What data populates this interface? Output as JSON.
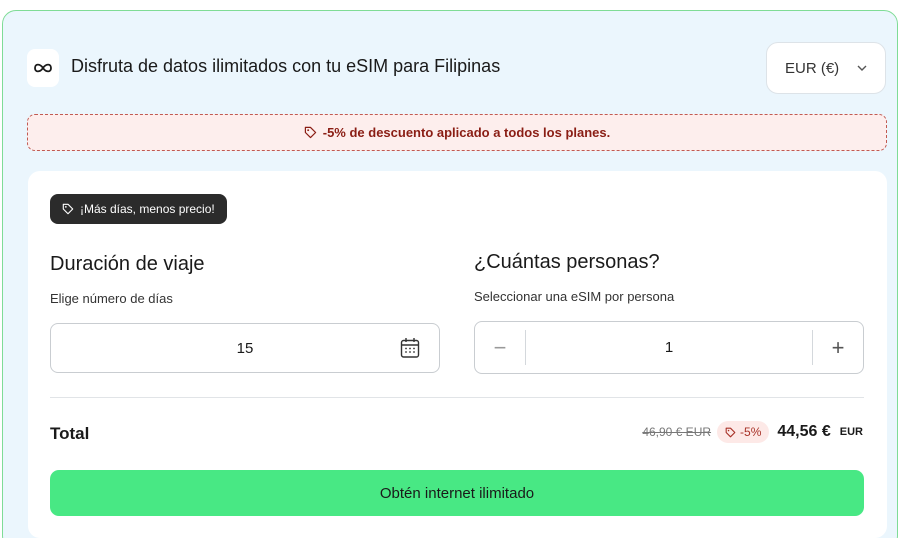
{
  "header": {
    "logo_icon": "infinity-icon",
    "title": "Disfruta de datos ilimitados con tu eSIM para Filipinas",
    "currency": {
      "label": "EUR (€)",
      "icon": "chevron-down-icon"
    }
  },
  "discount_banner": {
    "icon": "tag-icon",
    "text": "-5% de descuento aplicado a todos los planes."
  },
  "card": {
    "promo_badge": {
      "icon": "tag-icon",
      "text": "¡Más días, menos precio!"
    },
    "duration": {
      "title": "Duración de viaje",
      "subtitle": "Elige número de días",
      "value": "15",
      "icon": "calendar-icon"
    },
    "people": {
      "title": "¿Cuántas personas?",
      "subtitle": "Seleccionar una eSIM por persona",
      "minus": "−",
      "value": "1",
      "plus": "+"
    },
    "total": {
      "label": "Total",
      "old_price": "46,90 € EUR",
      "discount": "-5%",
      "new_price": "44,56 €",
      "new_currency": "EUR"
    },
    "cta_label": "Obtén internet ilimitado"
  },
  "colors": {
    "background": "#ebf6fd",
    "frame_border": "#7fdc96",
    "banner_bg": "#fdeeed",
    "banner_text": "#8a1d14",
    "cta": "#48e884",
    "badge_dark": "#2b2b2b"
  }
}
